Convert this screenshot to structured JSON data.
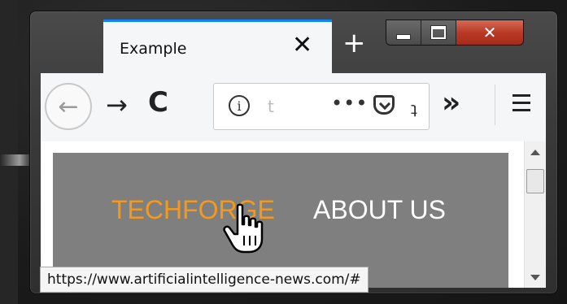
{
  "browser": {
    "tab": {
      "title": "Example",
      "close_glyph": "✕"
    },
    "new_tab_glyph": "+",
    "window_controls": {
      "close_glyph": "✕"
    },
    "toolbar": {
      "back_glyph": "←",
      "forward_glyph": "→",
      "reload_glyph": "C",
      "info_glyph": "i",
      "url_fragment": "t",
      "page_actions_glyph": "•••",
      "bookmark_stub": "ʇ",
      "overflow_glyph": "»"
    },
    "status_url": "https://www.artificialintelligence-news.com/#"
  },
  "page": {
    "nav": {
      "items": [
        {
          "label": "TECHFORGE",
          "color": "#f29a1e"
        },
        {
          "label": "ABOUT US",
          "color": "#ffffff"
        }
      ],
      "background": "#7f7f7f"
    }
  },
  "colors": {
    "accent_tab": "#0a84ff",
    "close_button": "#b83a26"
  }
}
